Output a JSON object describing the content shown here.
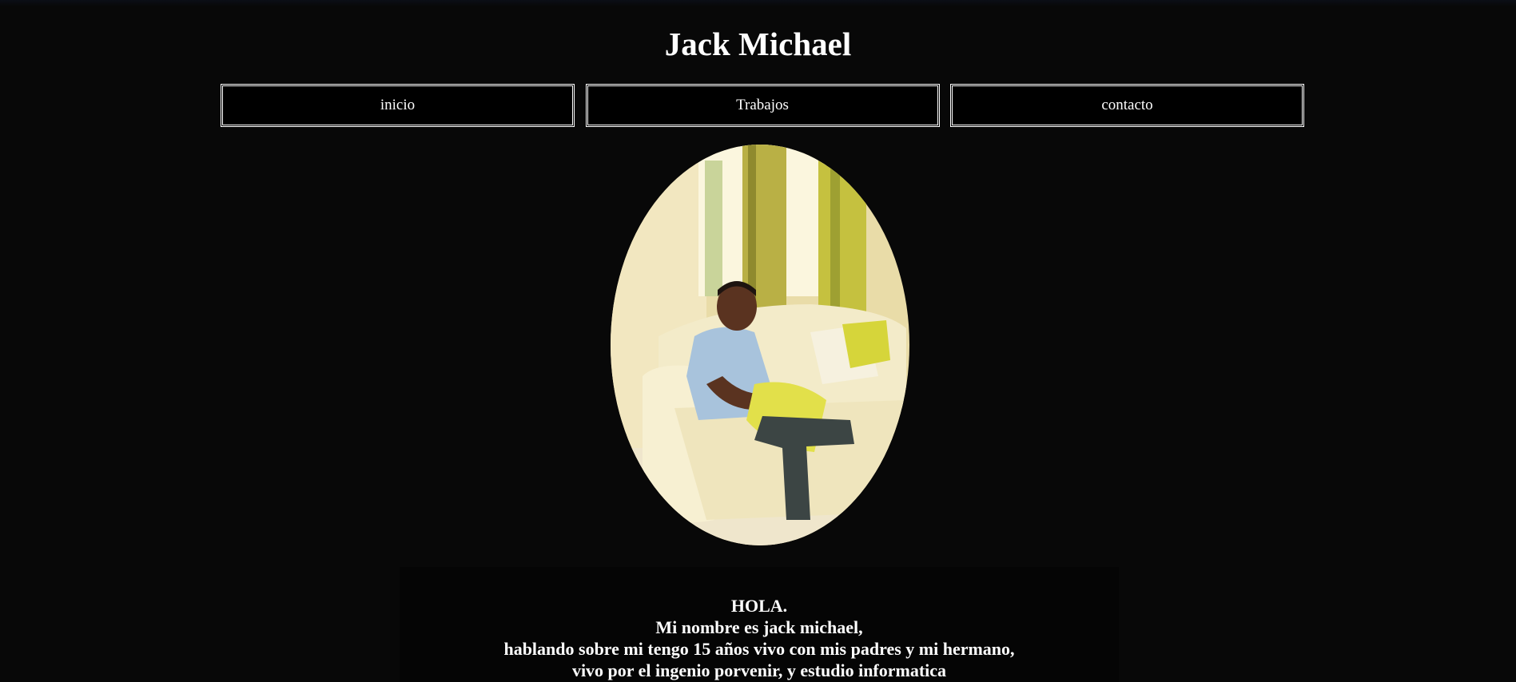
{
  "header": {
    "title": "Jack Michael"
  },
  "nav": {
    "items": [
      {
        "label": "inicio"
      },
      {
        "label": "Trabajos"
      },
      {
        "label": "contacto"
      }
    ]
  },
  "profile": {
    "photo_icon": "portrait-photo"
  },
  "intro": {
    "lines": [
      "HOLA.",
      "Mi nombre es jack michael,",
      "hablando sobre mi tengo 15 años vivo con mis padres y mi hermano,",
      "vivo por el ingenio porvenir, y estudio informatica"
    ]
  },
  "colors": {
    "background": "#080808",
    "text": "#ffffff",
    "nav_border": "#ffffff"
  }
}
